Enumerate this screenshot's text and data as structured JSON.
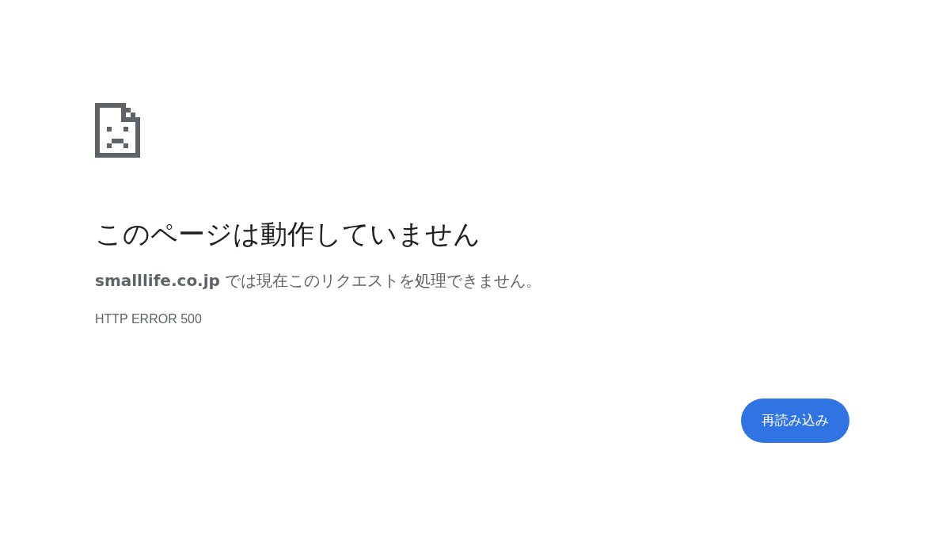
{
  "heading": "このページは動作していません",
  "message": "**smalllife.co.jp** では現在このリクエストを処理できません。",
  "error_code": "HTTP ERROR 500",
  "button": "再読み込み"
}
